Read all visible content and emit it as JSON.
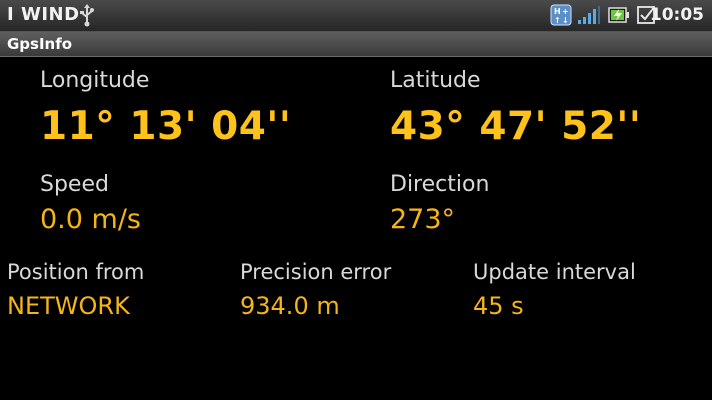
{
  "status_bar": {
    "carrier": "I WIND",
    "time": "10:05",
    "icons": [
      "usb-icon",
      "sim-toolkit-icon",
      "signal-icon",
      "battery-charging-icon",
      "checkbox-notification-icon"
    ]
  },
  "title_bar": {
    "title": "GpsInfo"
  },
  "gps": {
    "longitude": {
      "label": "Longitude",
      "value": "11° 13' 04''"
    },
    "latitude": {
      "label": "Latitude",
      "value": "43° 47' 52''"
    },
    "speed": {
      "label": "Speed",
      "value": "0.0 m/s"
    },
    "direction": {
      "label": "Direction",
      "value": "273°"
    },
    "position_from": {
      "label": "Position from",
      "value": "NETWORK"
    },
    "precision_error": {
      "label": "Precision error",
      "value": "934.0 m"
    },
    "update_interval": {
      "label": "Update interval",
      "value": "45 s"
    }
  },
  "colors": {
    "value": "#f5b417",
    "label": "#d9d9d9",
    "background": "#000000"
  }
}
